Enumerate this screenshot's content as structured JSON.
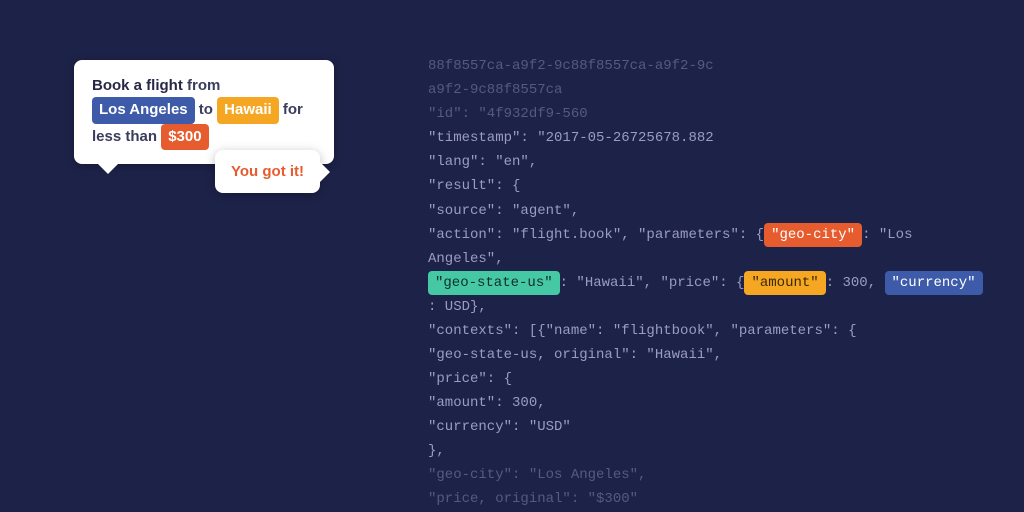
{
  "chat": {
    "user": {
      "pre1": "Book a flight",
      "mid1": " from ",
      "city": "Los Angeles",
      "mid2": " to ",
      "state": "Hawaii",
      "mid3": " for less than ",
      "price": "$300"
    },
    "agent": "You got it!"
  },
  "code": {
    "l1": "88f8557ca-a9f2-9c88f8557ca-a9f2-9c",
    "l2": "a9f2-9c88f8557ca",
    "l3": "\"id\": \"4f932df9-560",
    "l4": "\"timestamp\": \"2017-05-26725678.882",
    "l5": "\"lang\": \"en\",",
    "l6": "\"result\": {",
    "l7": "\"source\": \"agent\",",
    "l8a": "\"action\": \"flight.book\", \"parameters\": {",
    "l8_tag": "\"geo-city\"",
    "l8b": ": \"Los Angeles\",",
    "l9_tag1": "\"geo-state-us\"",
    "l9a": ": \"Hawaii\", \"price\": {",
    "l9_tag2": "\"amount\"",
    "l9b": ": 300, ",
    "l9_tag3": "\"currency\"",
    "l9c": ": USD},",
    "l10": "\"contexts\": [{\"name\": \"flightbook\", \"parameters\": {",
    "l11": "\"geo-state-us, original\": \"Hawaii\",",
    "l12": "\"price\": {",
    "l13": "\"amount\": 300,",
    "l14": "\"currency\": \"USD\"",
    "l15": "},",
    "l16": "\"geo-city\": \"Los Angeles\",",
    "l17": "\"price, original\": \"$300\""
  }
}
